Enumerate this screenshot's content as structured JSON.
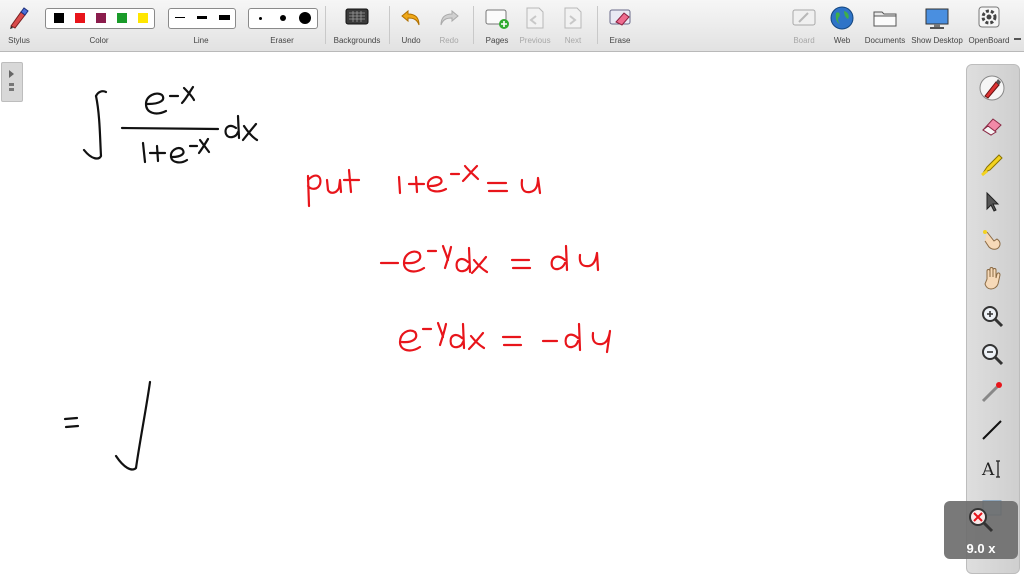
{
  "toolbar": {
    "stylus": "Stylus",
    "color": "Color",
    "line": "Line",
    "eraser": "Eraser",
    "backgrounds": "Backgrounds",
    "undo": "Undo",
    "redo": "Redo",
    "pages": "Pages",
    "previous": "Previous",
    "next": "Next",
    "erase": "Erase",
    "board": "Board",
    "web": "Web",
    "documents": "Documents",
    "show_desktop": "Show Desktop",
    "openboard": "OpenBoard"
  },
  "colors": [
    "#000000",
    "#e8151b",
    "#8b1d4d",
    "#1a9b2a",
    "#ffe600"
  ],
  "ink_color": "#e8151b",
  "zoom": "9.0 x"
}
